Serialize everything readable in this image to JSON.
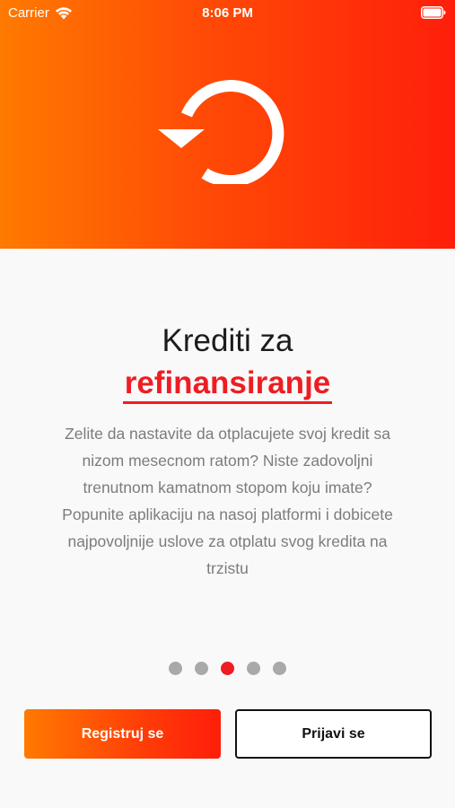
{
  "status_bar": {
    "carrier": "Carrier",
    "time": "8:06 PM"
  },
  "hero": {
    "icon": "refresh-icon",
    "gradient_start": "#ff7a00",
    "gradient_end": "#ff1e0a"
  },
  "content": {
    "title": "Krediti za",
    "highlight": "refinansiranje",
    "description": "Zelite da nastavite da otplacujete svoj kredit sa nizom mesecnom ratom? Niste zadovoljni trenutnom kamatnom stopom koju imate? Popunite aplikaciju na nasoj platformi i dobicete najpovoljnije uslove za otplatu svog kredita na trzistu"
  },
  "pagination": {
    "total": 5,
    "active_index": 2,
    "active_color": "#ee1d23",
    "inactive_color": "#a9a9a9"
  },
  "buttons": {
    "register_label": "Registruj se",
    "login_label": "Prijavi se"
  }
}
